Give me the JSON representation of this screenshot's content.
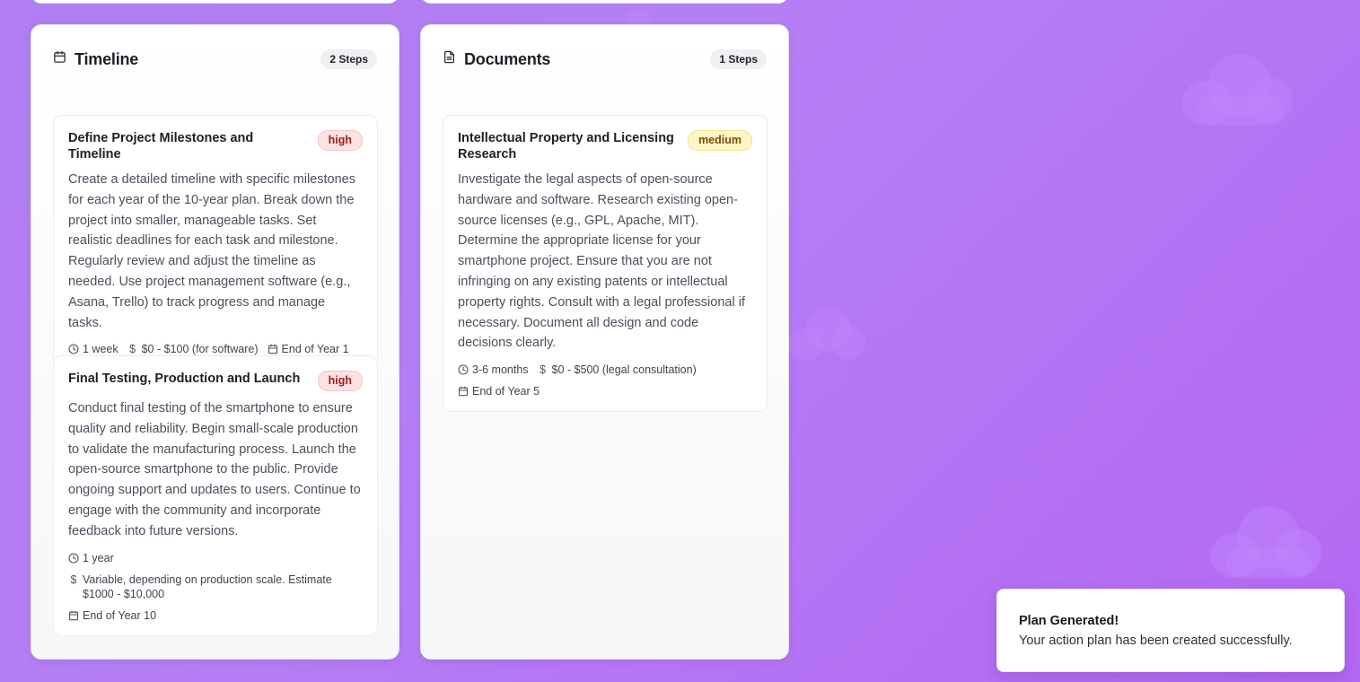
{
  "columns": [
    {
      "title": "Timeline",
      "icon": "calendar-icon",
      "steps_badge": "2 Steps",
      "cards": [
        {
          "title": "Define Project Milestones and Timeline",
          "priority": "high",
          "description": "Create a detailed timeline with specific milestones for each year of the 10-year plan. Break down the project into smaller, manageable tasks. Set realistic deadlines for each task and milestone. Regularly review and adjust the timeline as needed. Use project management software (e.g., Asana, Trello) to track progress and manage tasks.",
          "duration": "1 week",
          "cost": "$0 - $100 (for software)",
          "deadline": "End of Year 1"
        },
        {
          "title": "Final Testing, Production and Launch",
          "priority": "high",
          "description": "Conduct final testing of the smartphone to ensure quality and reliability. Begin small-scale production to validate the manufacturing process. Launch the open-source smartphone to the public. Provide ongoing support and updates to users. Continue to engage with the community and incorporate feedback into future versions.",
          "duration": "1 year",
          "cost": "Variable, depending on production scale. Estimate $1000 - $10,000",
          "deadline": "End of Year 10"
        }
      ]
    },
    {
      "title": "Documents",
      "icon": "document-icon",
      "steps_badge": "1 Steps",
      "cards": [
        {
          "title": "Intellectual Property and Licensing Research",
          "priority": "medium",
          "description": "Investigate the legal aspects of open-source hardware and software. Research existing open-source licenses (e.g., GPL, Apache, MIT). Determine the appropriate license for your smartphone project. Ensure that you are not infringing on any existing patents or intellectual property rights. Consult with a legal professional if necessary. Document all design and code decisions clearly.",
          "duration": "3-6 months",
          "cost": "$0 - $500 (legal consultation)",
          "deadline": "End of Year 5"
        }
      ]
    }
  ],
  "toast": {
    "title": "Plan Generated!",
    "message": "Your action plan has been created successfully."
  },
  "colors": {
    "background": "#b57ef5",
    "high_badge_bg": "#fde2e2",
    "high_badge_text": "#9b1c1c",
    "medium_badge_bg": "#fef6c3",
    "medium_badge_text": "#7a4d06"
  }
}
